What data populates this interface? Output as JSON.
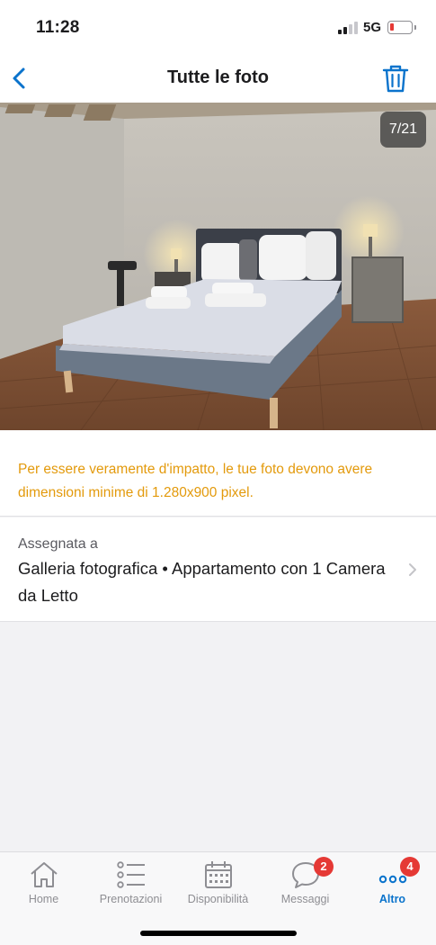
{
  "status_bar": {
    "time": "11:28",
    "network": "5G",
    "battery_level": 0.15,
    "battery_color": "#e53935"
  },
  "nav": {
    "title": "Tutte le foto",
    "back_icon": "chevron-left-icon",
    "delete_icon": "trash-icon",
    "accent_color": "#0a73cc"
  },
  "photo": {
    "counter": "7/21"
  },
  "warning": {
    "text": "Per essere veramente d'impatto, le tue foto devono avere dimensioni minime di 1.280x900 pixel.",
    "color": "#e39a0c"
  },
  "assigned": {
    "label": "Assegnata a",
    "value": "Galleria fotografica • Appartamento con 1 Camera da Letto"
  },
  "tabs": [
    {
      "label": "Home",
      "icon": "home-icon",
      "active": false,
      "badge": null
    },
    {
      "label": "Prenotazioni",
      "icon": "list-icon",
      "active": false,
      "badge": null
    },
    {
      "label": "Disponibilità",
      "icon": "calendar-icon",
      "active": false,
      "badge": null
    },
    {
      "label": "Messaggi",
      "icon": "chat-icon",
      "active": false,
      "badge": "2"
    },
    {
      "label": "Altro",
      "icon": "more-icon",
      "active": true,
      "badge": "4"
    }
  ]
}
